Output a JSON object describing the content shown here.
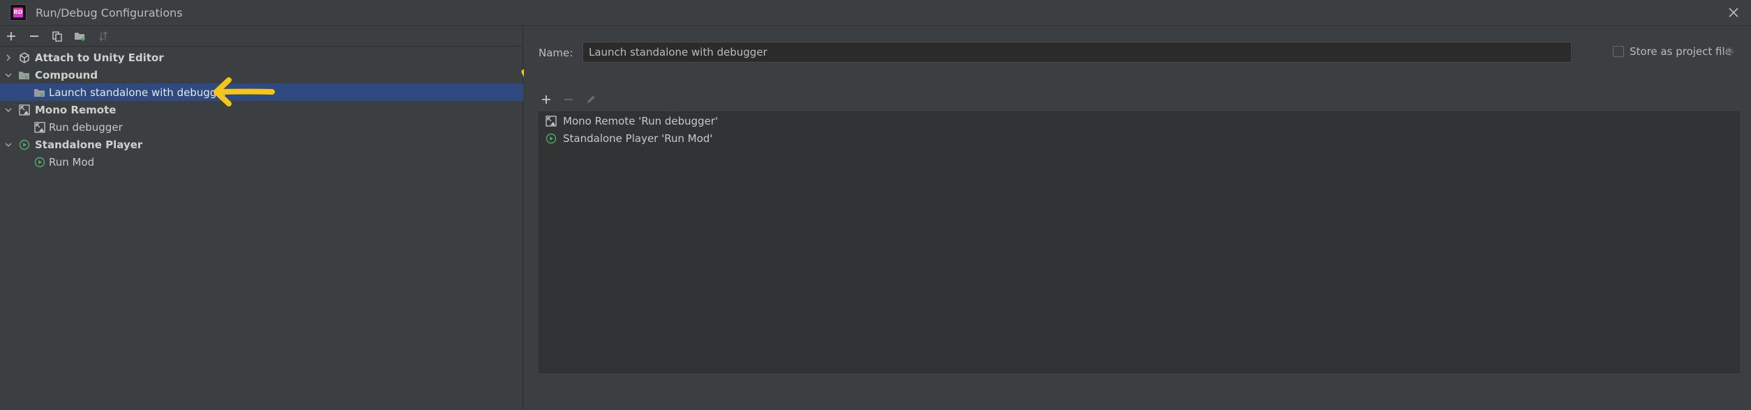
{
  "window": {
    "title": "Run/Debug Configurations",
    "logo_icon": "rider-logo-icon",
    "logo_text": "RD",
    "close_icon": "close-icon"
  },
  "toolbar": {
    "buttons": [
      {
        "name": "add-configuration-button",
        "icon": "plus-icon"
      },
      {
        "name": "remove-configuration-button",
        "icon": "minus-icon"
      },
      {
        "name": "copy-configuration-button",
        "icon": "copy-icon"
      },
      {
        "name": "new-folder-button",
        "icon": "folder-add-icon"
      },
      {
        "name": "sort-button",
        "icon": "sort-icon"
      }
    ]
  },
  "tree": {
    "items": [
      {
        "label": "Attach to Unity Editor",
        "level": 0,
        "expanded": false,
        "bold": true,
        "icon": "unity-icon",
        "selected": false
      },
      {
        "label": "Compound",
        "level": 0,
        "expanded": true,
        "bold": true,
        "icon": "compound-folder-icon",
        "selected": false
      },
      {
        "label": "Launch standalone with debugger",
        "level": 1,
        "bold": false,
        "icon": "compound-config-icon",
        "selected": true
      },
      {
        "label": "Mono Remote",
        "level": 0,
        "expanded": true,
        "bold": true,
        "icon": "mono-remote-icon",
        "selected": false
      },
      {
        "label": "Run debugger",
        "level": 1,
        "bold": false,
        "icon": "mono-remote-icon",
        "selected": false
      },
      {
        "label": "Standalone Player",
        "level": 0,
        "expanded": true,
        "bold": true,
        "icon": "play-circle-icon",
        "selected": false
      },
      {
        "label": "Run Mod",
        "level": 1,
        "bold": false,
        "icon": "play-circle-icon",
        "selected": false
      }
    ]
  },
  "form": {
    "name_label": "Name:",
    "name_value": "Launch standalone with debugger",
    "store_label": "Store as project file",
    "store_checked": false,
    "gear_icon": "gear-icon"
  },
  "compound_list": {
    "toolbar": [
      {
        "name": "add-entry-button",
        "icon": "plus-icon",
        "enabled": true
      },
      {
        "name": "remove-entry-button",
        "icon": "minus-icon",
        "enabled": false
      },
      {
        "name": "edit-entry-button",
        "icon": "pencil-icon",
        "enabled": false
      }
    ],
    "items": [
      {
        "label": "Mono Remote 'Run debugger'",
        "icon": "mono-remote-icon"
      },
      {
        "label": "Standalone Player 'Run Mod'",
        "icon": "play-circle-icon"
      }
    ]
  },
  "annotations": {
    "color": "#f5c518",
    "arrows": [
      {
        "name": "annotation-arrow-left",
        "icon": "arrow-left-icon"
      },
      {
        "name": "annotation-arrow-down-right",
        "icon": "arrow-down-right-icon"
      }
    ]
  },
  "colors": {
    "background": "#3c3f41",
    "selection": "#2f4a80",
    "input_bg": "#2b2b2b",
    "list_bg": "#313335",
    "text": "#bbbbbb",
    "accent_green": "#59a869"
  }
}
